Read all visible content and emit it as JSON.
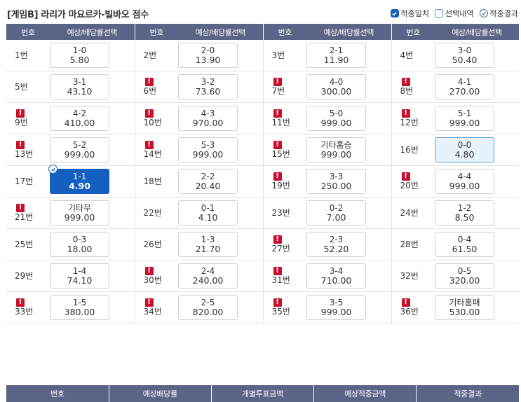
{
  "title": "[게임B] 라리가 마요르카-빌바오 점수",
  "legend": [
    {
      "label": "적중일치",
      "style": "filled",
      "icon": "checkbox-checked-icon"
    },
    {
      "label": "선택내역",
      "style": "empty",
      "icon": "checkbox-empty-icon"
    },
    {
      "label": "적중결과",
      "style": "circle",
      "icon": "circle-check-icon"
    }
  ],
  "columns": {
    "num": "번호",
    "pick": "예상/배당률선택"
  },
  "warn_symbol": "!",
  "rows": [
    [
      {
        "num": "1번",
        "score": "1-0",
        "odds": "5.80",
        "warn": false
      },
      {
        "num": "2번",
        "score": "2-0",
        "odds": "13.90",
        "warn": false
      },
      {
        "num": "3번",
        "score": "2-1",
        "odds": "11.90",
        "warn": false
      },
      {
        "num": "4번",
        "score": "3-0",
        "odds": "50.40",
        "warn": false
      }
    ],
    [
      {
        "num": "5번",
        "score": "3-1",
        "odds": "43.10",
        "warn": false
      },
      {
        "num": "6번",
        "score": "3-2",
        "odds": "73.60",
        "warn": true
      },
      {
        "num": "7번",
        "score": "4-0",
        "odds": "300.00",
        "warn": true
      },
      {
        "num": "8번",
        "score": "4-1",
        "odds": "270.00",
        "warn": true
      }
    ],
    [
      {
        "num": "9번",
        "score": "4-2",
        "odds": "410.00",
        "warn": true
      },
      {
        "num": "10번",
        "score": "4-3",
        "odds": "970.00",
        "warn": true
      },
      {
        "num": "11번",
        "score": "5-0",
        "odds": "999.00",
        "warn": true
      },
      {
        "num": "12번",
        "score": "5-1",
        "odds": "999.00",
        "warn": true
      }
    ],
    [
      {
        "num": "13번",
        "score": "5-2",
        "odds": "999.00",
        "warn": true
      },
      {
        "num": "14번",
        "score": "5-3",
        "odds": "999.00",
        "warn": true
      },
      {
        "num": "15번",
        "score": "기타홈승",
        "odds": "999.00",
        "warn": true
      },
      {
        "num": "16번",
        "score": "0-0",
        "odds": "4.80",
        "warn": false,
        "state": "highlight"
      }
    ],
    [
      {
        "num": "17번",
        "score": "1-1",
        "odds": "4.90",
        "warn": false,
        "state": "selected"
      },
      {
        "num": "18번",
        "score": "2-2",
        "odds": "20.40",
        "warn": false
      },
      {
        "num": "19번",
        "score": "3-3",
        "odds": "250.00",
        "warn": true
      },
      {
        "num": "20번",
        "score": "4-4",
        "odds": "999.00",
        "warn": true
      }
    ],
    [
      {
        "num": "21번",
        "score": "기타무",
        "odds": "999.00",
        "warn": true
      },
      {
        "num": "22번",
        "score": "0-1",
        "odds": "4.10",
        "warn": false
      },
      {
        "num": "23번",
        "score": "0-2",
        "odds": "7.00",
        "warn": false
      },
      {
        "num": "24번",
        "score": "1-2",
        "odds": "8.50",
        "warn": false
      }
    ],
    [
      {
        "num": "25번",
        "score": "0-3",
        "odds": "18.00",
        "warn": false
      },
      {
        "num": "26번",
        "score": "1-3",
        "odds": "21.70",
        "warn": false
      },
      {
        "num": "27번",
        "score": "2-3",
        "odds": "52.20",
        "warn": true
      },
      {
        "num": "28번",
        "score": "0-4",
        "odds": "61.50",
        "warn": false
      }
    ],
    [
      {
        "num": "29번",
        "score": "1-4",
        "odds": "74.10",
        "warn": false
      },
      {
        "num": "30번",
        "score": "2-4",
        "odds": "240.00",
        "warn": true
      },
      {
        "num": "31번",
        "score": "3-4",
        "odds": "710.00",
        "warn": true
      },
      {
        "num": "32번",
        "score": "0-5",
        "odds": "320.00",
        "warn": false
      }
    ],
    [
      {
        "num": "33번",
        "score": "1-5",
        "odds": "380.00",
        "warn": true
      },
      {
        "num": "34번",
        "score": "2-5",
        "odds": "820.00",
        "warn": true
      },
      {
        "num": "35번",
        "score": "3-5",
        "odds": "999.00",
        "warn": true
      },
      {
        "num": "36번",
        "score": "기타홈패",
        "odds": "530.00",
        "warn": true
      }
    ]
  ],
  "bottom_headers": [
    "번호",
    "예상배당률",
    "개별투표금액",
    "예상적중금액",
    "적중결과"
  ],
  "colors": {
    "header_bg": "#5b6386",
    "selected": "#1360c0",
    "warn": "#c8102e",
    "highlight_bg": "#e7f2fc"
  }
}
